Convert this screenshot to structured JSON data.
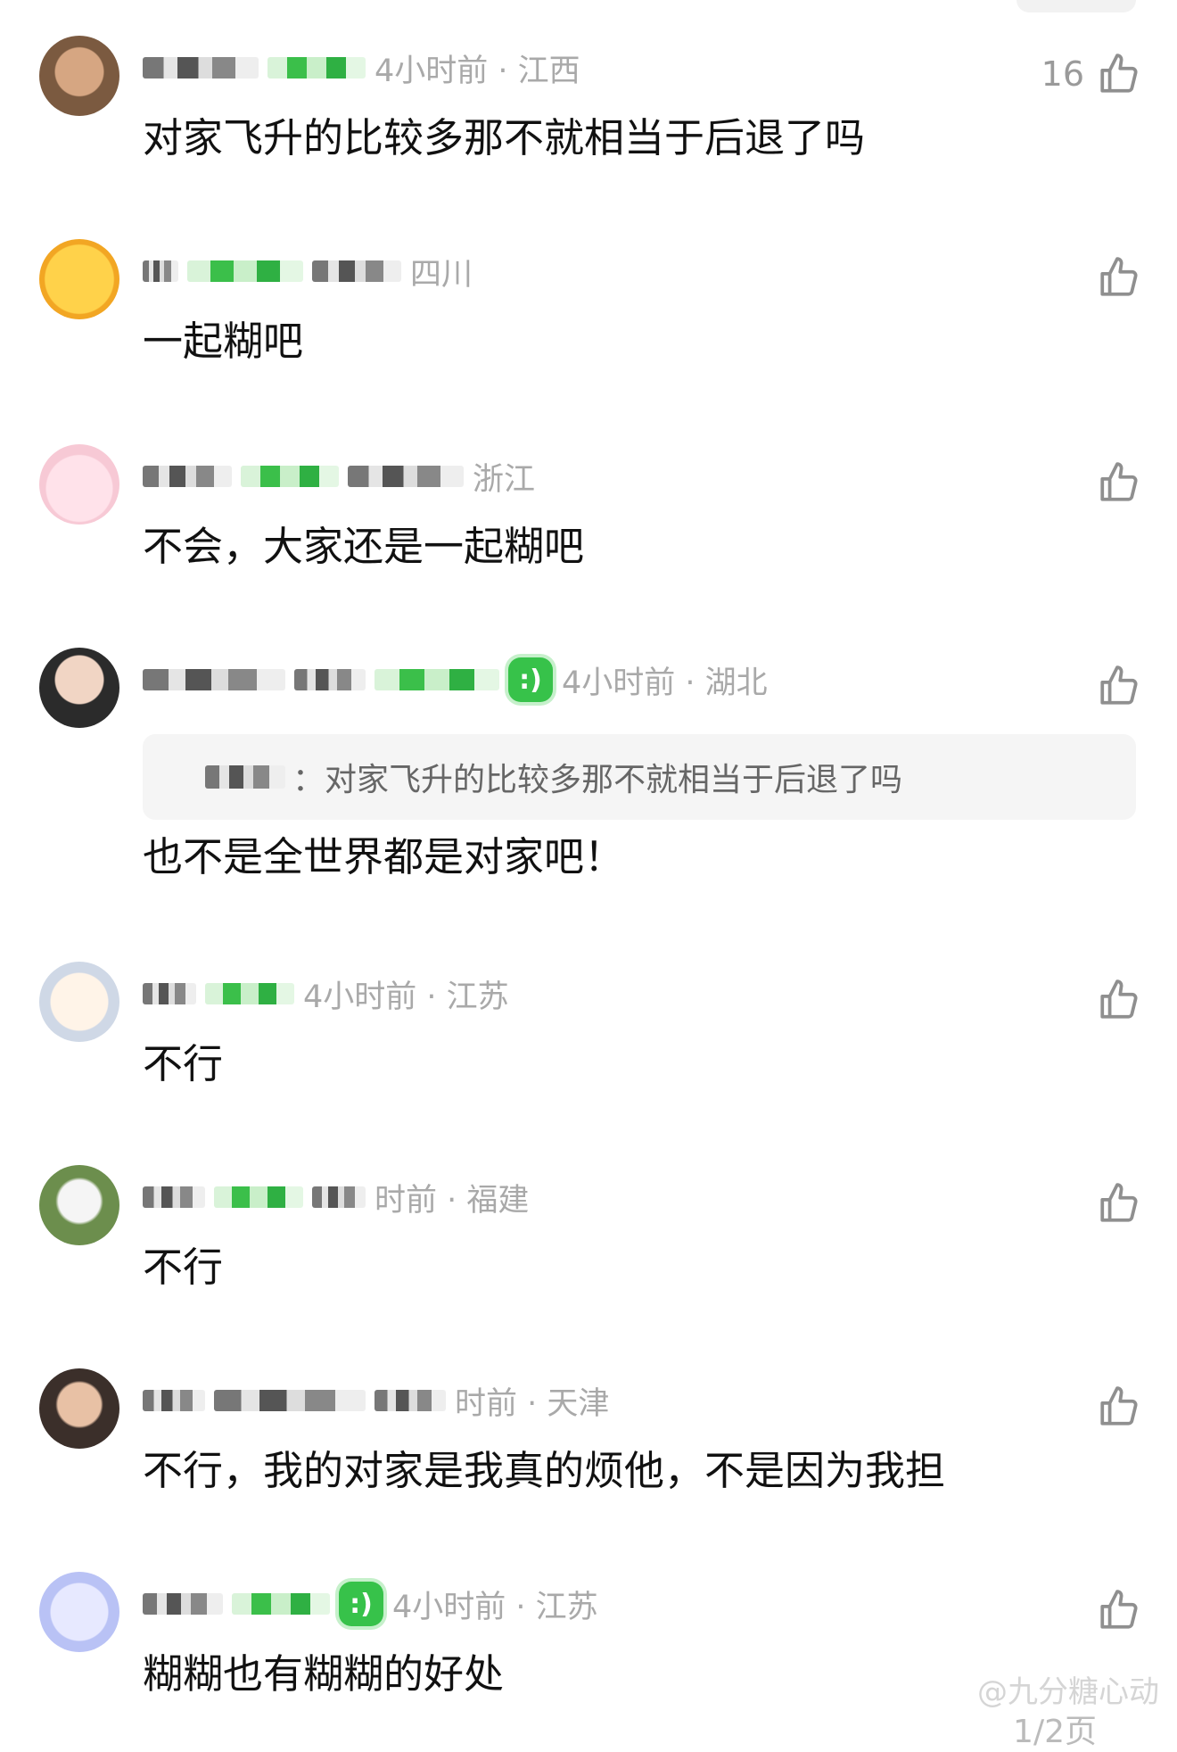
{
  "comments": [
    {
      "location": "4小时前 · 江西",
      "text": "对家飞升的比较多那不就相当于后退了吗",
      "likes": "16"
    },
    {
      "location": "四川",
      "text": "一起糊吧",
      "likes": ""
    },
    {
      "location": "浙江",
      "text": "不会，大家还是一起糊吧",
      "likes": ""
    },
    {
      "location": "4小时前 · 湖北",
      "text": "也不是全世界都是对家吧！",
      "likes": "",
      "quote": "：对家飞升的比较多那不就相当于后退了吗"
    },
    {
      "location": "4小时前 · 江苏",
      "text": "不行",
      "likes": ""
    },
    {
      "location": "时前 · 福建",
      "text": "不行",
      "likes": ""
    },
    {
      "location": "时前 · 天津",
      "text": "不行，我的对家是我真的烦他，不是因为我担",
      "likes": ""
    },
    {
      "location": "4小时前 · 江苏",
      "text": "糊糊也有糊糊的好处",
      "likes": ""
    }
  ],
  "watermark": "@九分糖心动",
  "page_indicator": "1/2页",
  "icons": {
    "like": "thumbs-up-icon",
    "badge": "smile-badge-icon"
  },
  "colors": {
    "accent": "#37c24a",
    "meta": "#a9a9a9",
    "text": "#111111"
  }
}
